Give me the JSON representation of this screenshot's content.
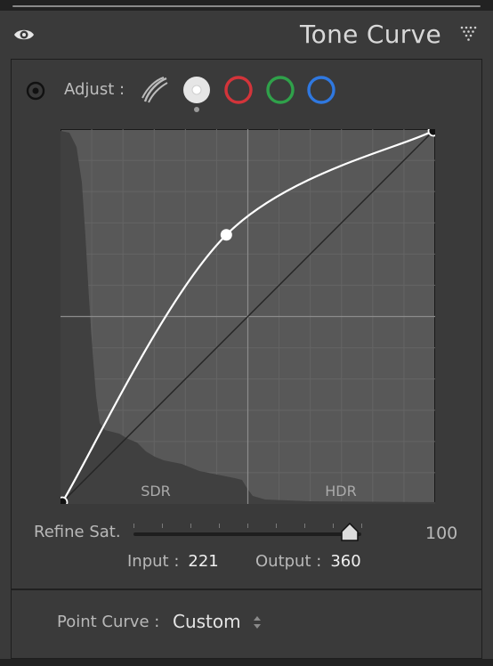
{
  "header": {
    "title": "Tone Curve"
  },
  "adjust": {
    "label": "Adjust :",
    "channels": [
      "parametric-curve",
      "point-curve-rgb",
      "red",
      "green",
      "blue"
    ],
    "colors": {
      "red": "#d3343a",
      "green": "#2fa14a",
      "blue": "#2f78e0"
    }
  },
  "graph": {
    "zone_left": "SDR",
    "zone_right": "HDR",
    "points": [
      {
        "input": 0,
        "output": 0
      },
      {
        "input": 221,
        "output": 360
      },
      {
        "input": 500,
        "output": 500
      }
    ],
    "max": 500
  },
  "refine": {
    "label": "Refine Sat.",
    "value": "100",
    "level": 0.95
  },
  "readout": {
    "input_label": "Input :",
    "input_value": "221",
    "output_label": "Output :",
    "output_value": "360"
  },
  "point_curve": {
    "label": "Point Curve :",
    "value": "Custom"
  }
}
